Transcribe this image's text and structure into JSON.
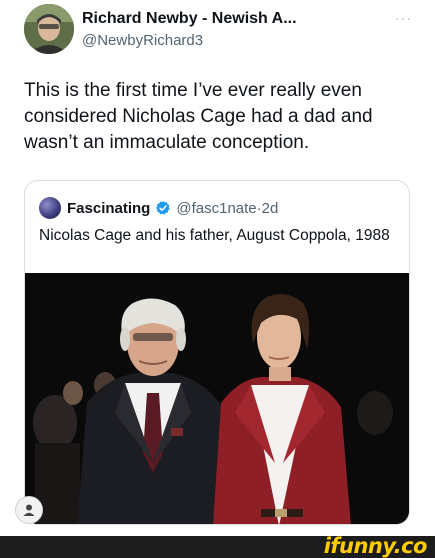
{
  "tweet": {
    "author_name": "Richard Newby - Newish A...",
    "author_handle": "@NewbyRichard3",
    "more_label": "···",
    "text": "This is the first time I’ve ever really even considered Nicholas Cage had a dad and wasn’t an immaculate conception."
  },
  "quote": {
    "author_name": "Fascinating",
    "author_handle": "@fasc1nate",
    "separator": "·",
    "time": "2d",
    "text": "Nicolas Cage and his father, August Coppola, 1988",
    "verified_color": "#1d9bf0"
  },
  "icons": {
    "verified": "verified-badge-icon",
    "user": "user-icon",
    "more": "more-dots-icon"
  },
  "footer": {
    "logo": "ifunny.co",
    "logo_color": "#ffcc00"
  }
}
